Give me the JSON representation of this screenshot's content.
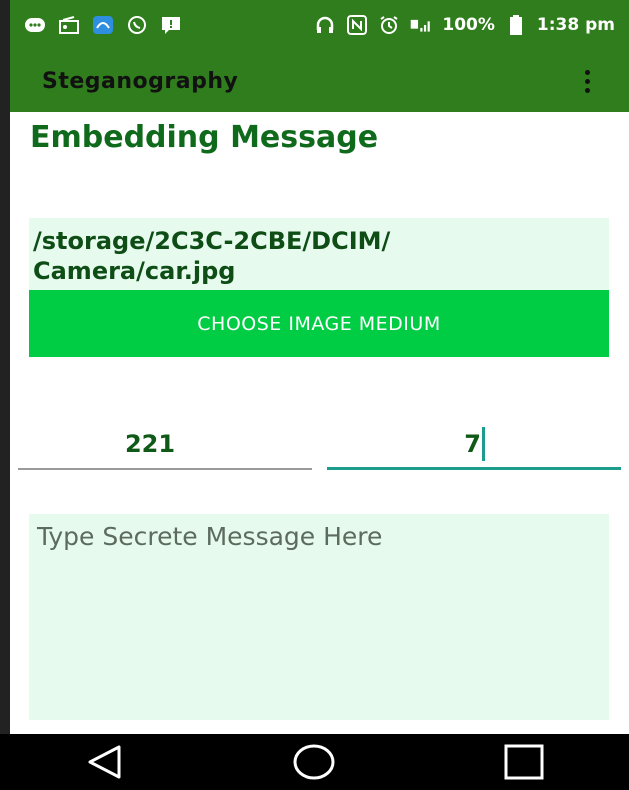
{
  "status_bar": {
    "battery": "100%",
    "time": "1:38 pm"
  },
  "app_bar": {
    "title": "Steganography"
  },
  "heading": "Embedding Message",
  "image_path": "/storage/2C3C-2CBE/DCIM/\nCamera/car.jpg",
  "choose_button_label": "CHOOSE IMAGE MEDIUM",
  "fields": {
    "first_value": "221",
    "second_value": "7"
  },
  "message": {
    "placeholder": "Type Secrete Message Here",
    "value": ""
  },
  "colors": {
    "app_bar": "#2f7d1c",
    "accent_button": "#00cc44",
    "field_background": "#e6fbee",
    "active_underline": "#1b9c8c"
  },
  "icons": {
    "status": [
      "message-icon",
      "radio-icon",
      "app-icon",
      "whatsapp-icon",
      "notification-icon",
      "headphones-icon",
      "nfc-icon",
      "alarm-icon",
      "signal-icon",
      "battery-icon"
    ],
    "nav": [
      "back-icon",
      "home-icon",
      "recents-icon"
    ]
  }
}
